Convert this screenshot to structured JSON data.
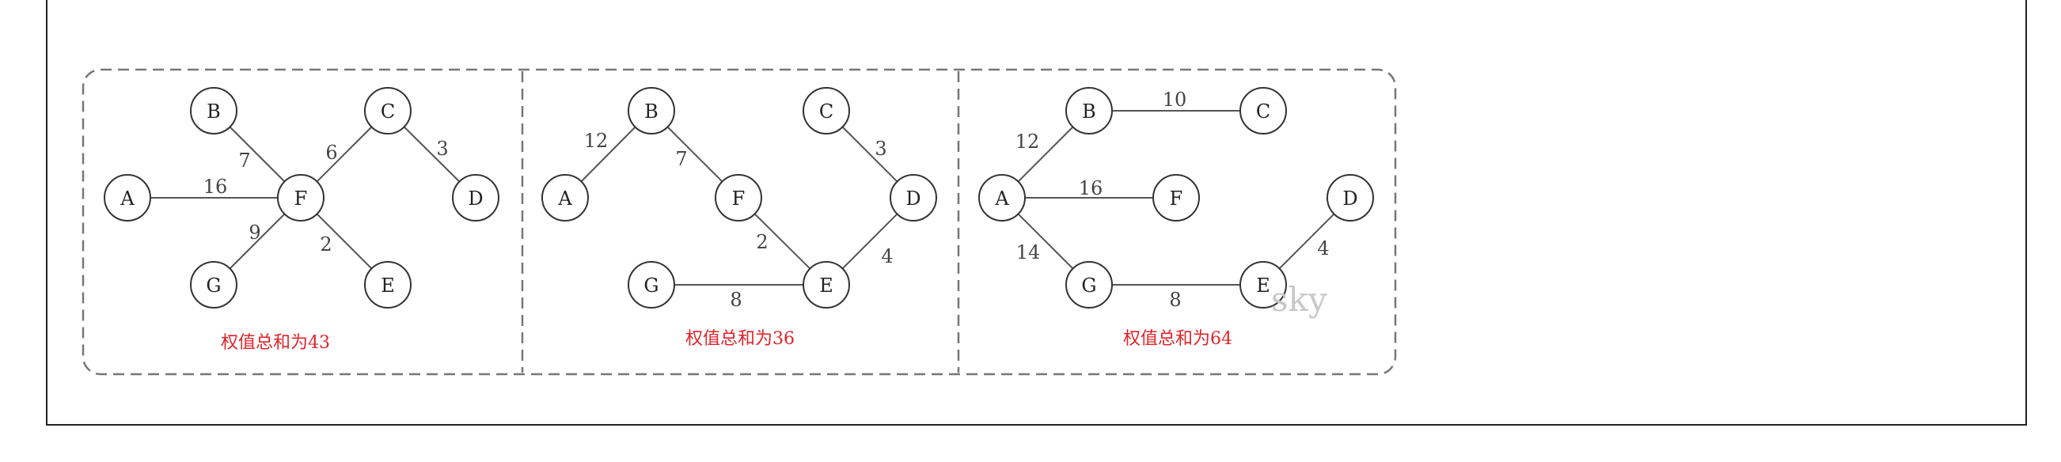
{
  "panels": [
    {
      "id": "p1",
      "caption": "权值总和为43",
      "nodes": [
        {
          "id": "A",
          "label": "A"
        },
        {
          "id": "B",
          "label": "B"
        },
        {
          "id": "C",
          "label": "C"
        },
        {
          "id": "D",
          "label": "D"
        },
        {
          "id": "E",
          "label": "E"
        },
        {
          "id": "F",
          "label": "F"
        },
        {
          "id": "G",
          "label": "G"
        }
      ],
      "edges": [
        {
          "from": "A",
          "to": "F",
          "weight": "16"
        },
        {
          "from": "B",
          "to": "F",
          "weight": "7"
        },
        {
          "from": "C",
          "to": "F",
          "weight": "6"
        },
        {
          "from": "C",
          "to": "D",
          "weight": "3"
        },
        {
          "from": "G",
          "to": "F",
          "weight": "9"
        },
        {
          "from": "F",
          "to": "E",
          "weight": "2"
        }
      ]
    },
    {
      "id": "p2",
      "caption": "权值总和为36",
      "nodes": [
        {
          "id": "A",
          "label": "A"
        },
        {
          "id": "B",
          "label": "B"
        },
        {
          "id": "C",
          "label": "C"
        },
        {
          "id": "D",
          "label": "D"
        },
        {
          "id": "E",
          "label": "E"
        },
        {
          "id": "F",
          "label": "F"
        },
        {
          "id": "G",
          "label": "G"
        }
      ],
      "edges": [
        {
          "from": "A",
          "to": "B",
          "weight": "12"
        },
        {
          "from": "B",
          "to": "F",
          "weight": "7"
        },
        {
          "from": "C",
          "to": "D",
          "weight": "3"
        },
        {
          "from": "F",
          "to": "E",
          "weight": "2"
        },
        {
          "from": "D",
          "to": "E",
          "weight": "4"
        },
        {
          "from": "G",
          "to": "E",
          "weight": "8"
        }
      ]
    },
    {
      "id": "p3",
      "caption": "权值总和为64",
      "nodes": [
        {
          "id": "A",
          "label": "A"
        },
        {
          "id": "B",
          "label": "B"
        },
        {
          "id": "C",
          "label": "C"
        },
        {
          "id": "D",
          "label": "D"
        },
        {
          "id": "E",
          "label": "E"
        },
        {
          "id": "F",
          "label": "F"
        },
        {
          "id": "G",
          "label": "G"
        }
      ],
      "edges": [
        {
          "from": "B",
          "to": "C",
          "weight": "10"
        },
        {
          "from": "A",
          "to": "B",
          "weight": "12"
        },
        {
          "from": "A",
          "to": "F",
          "weight": "16"
        },
        {
          "from": "A",
          "to": "G",
          "weight": "14"
        },
        {
          "from": "G",
          "to": "E",
          "weight": "8"
        },
        {
          "from": "D",
          "to": "E",
          "weight": "4"
        }
      ]
    }
  ],
  "watermark": "sky",
  "colors": {
    "caption": "#e0242a",
    "edge": "#555555",
    "node_stroke": "#333333",
    "dash": "#777777"
  }
}
